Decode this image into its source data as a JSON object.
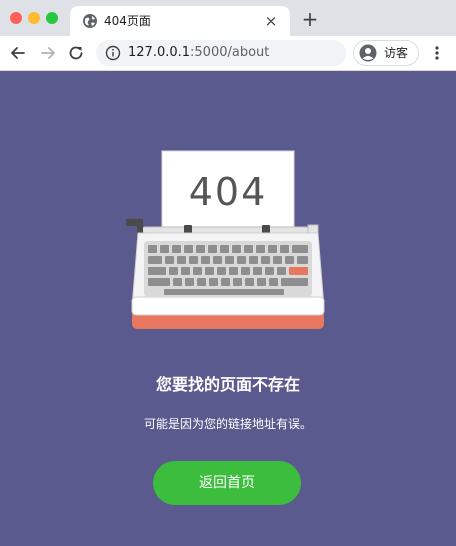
{
  "browser": {
    "tab_title": "404页面",
    "tab_close": "×",
    "new_tab": "+",
    "url_host": "127.0.0.1",
    "url_path": ":5000/about",
    "profile_label": "访客"
  },
  "page": {
    "error_code": "404",
    "heading": "您要找的页面不存在",
    "subtext": "可能是因为您的链接地址有误。",
    "home_button": "返回首页",
    "colors": {
      "background": "#5b5a8e",
      "button": "#3dbd3d",
      "typewriter_accent": "#e8775f"
    }
  },
  "icons": [
    "globe-icon",
    "back-arrow-icon",
    "forward-arrow-icon",
    "reload-icon",
    "info-icon",
    "avatar-icon",
    "kebab-menu-icon",
    "typewriter-illustration"
  ]
}
